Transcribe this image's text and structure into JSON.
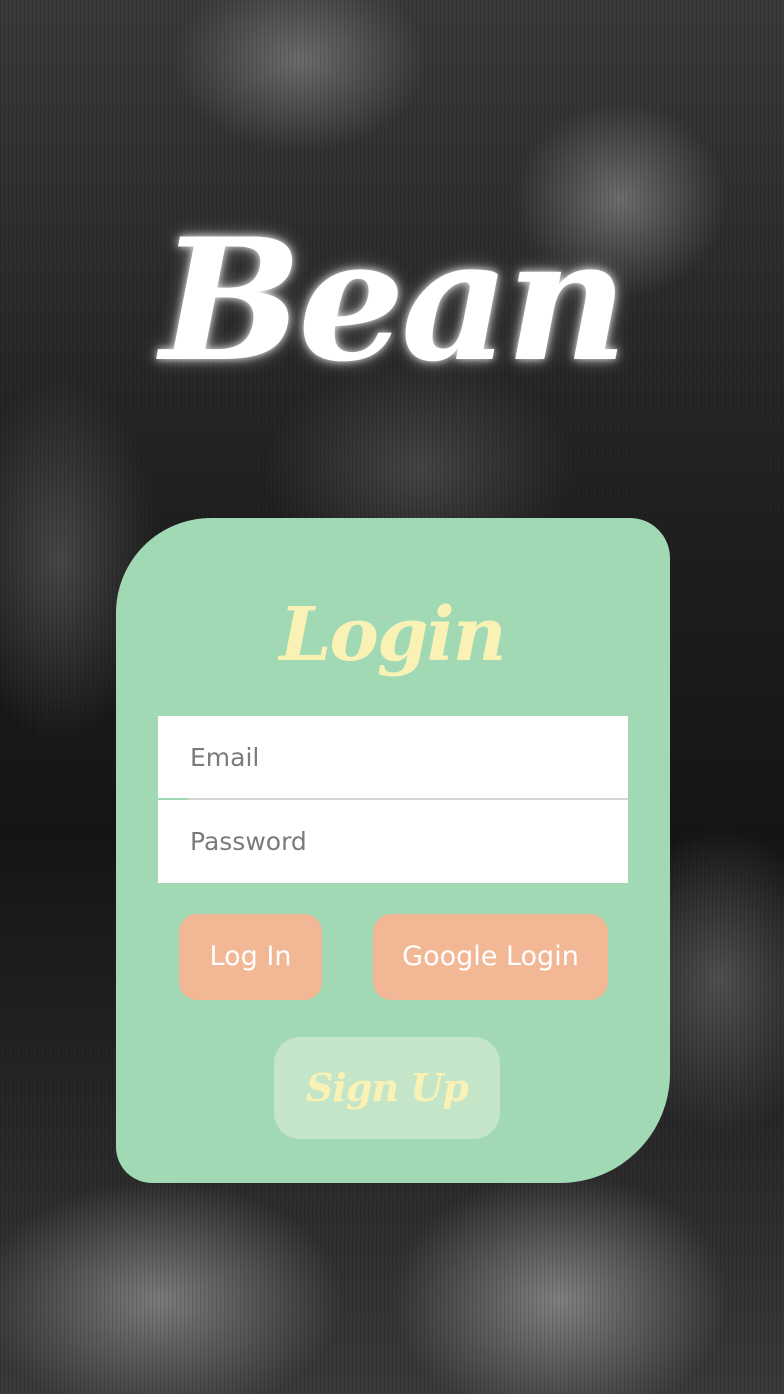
{
  "app": {
    "brand": "Bean"
  },
  "login_card": {
    "title": "Login",
    "email_placeholder": "Email",
    "password_placeholder": "Password",
    "login_button": "Log In",
    "google_button": "Google Login",
    "signup_button": "Sign Up"
  },
  "colors": {
    "card_background": "#a1d9b5",
    "title_color": "#faf2b4",
    "button_background": "#f2b895",
    "signup_background": "#c4e5c8"
  }
}
